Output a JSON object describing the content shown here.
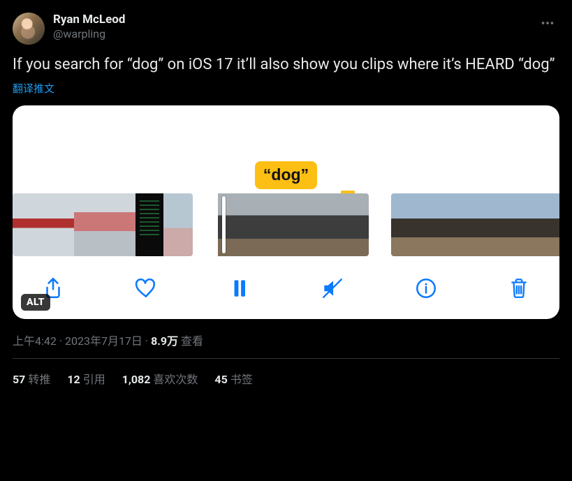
{
  "author": {
    "display_name": "Ryan McLeod",
    "handle": "@warpling"
  },
  "tweet_text": "If you search for “dog” on iOS 17 it’ll also show you clips where it’s HEARD “dog”",
  "translate_label": "翻译推文",
  "media": {
    "caption_bubble": "“dog”",
    "alt_badge": "ALT",
    "toolbar_icons": [
      "share",
      "like",
      "pause",
      "mute",
      "info",
      "trash"
    ]
  },
  "meta": {
    "time": "上午4:42",
    "dot1": " · ",
    "date": "2023年7月17日",
    "dot2": " · ",
    "views_count": "8.9万",
    "views_label": " 查看"
  },
  "stats": {
    "retweets": {
      "count": "57",
      "label": "转推"
    },
    "quotes": {
      "count": "12",
      "label": "引用"
    },
    "likes": {
      "count": "1,082",
      "label": "喜欢次数"
    },
    "bookmarks": {
      "count": "45",
      "label": "书签"
    }
  }
}
